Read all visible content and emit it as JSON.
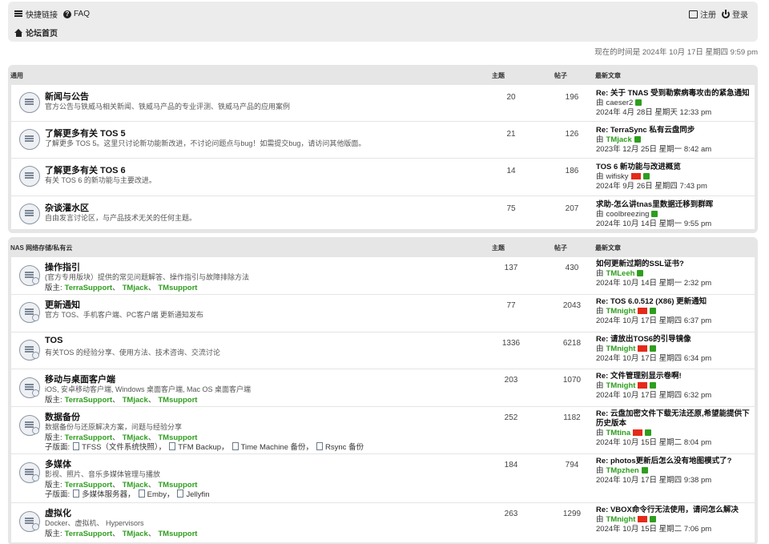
{
  "nav": {
    "quicklinks": "快捷链接",
    "faq": "FAQ",
    "home": "论坛首页",
    "register": "注册",
    "login": "登录"
  },
  "time": "现在的时间是 2024年 10月 17日 星期四 9:59 pm",
  "sections": [
    {
      "name": "通用",
      "col_topics": "主题",
      "col_posts": "帖子",
      "col_last": "最新文章",
      "forums": [
        {
          "title": "新闻与公告",
          "desc": "官方公告与铁威马相关新闻、铁威马产品的专业评测、铁威马产品的应用案例",
          "topics": "20",
          "posts": "196",
          "last_title": "Re: 关于 TNAS 受到勒索病毒攻击的紧急通知",
          "by": "由",
          "author": "caeser2",
          "author_plain": true,
          "flag": false,
          "date": "2024年 4月 28日 星期天 12:33 pm"
        },
        {
          "title": "了解更多有关 TOS 5",
          "desc": "了解更多 TOS 5。这里只讨论新功能新改进，不讨论问题点与bug！如需提交bug，请访问其他版面。",
          "topics": "21",
          "posts": "126",
          "last_title": "Re: TerraSync 私有云盘同步",
          "by": "由",
          "author": "TMjack",
          "author_plain": false,
          "flag": false,
          "date": "2023年 12月 25日 星期一 8:42 am"
        },
        {
          "title": "了解更多有关 TOS 6",
          "desc": "有关 TOS 6 的新功能与主要改进。",
          "topics": "14",
          "posts": "186",
          "last_title": "TOS 6 新功能与改进概览",
          "by": "由",
          "author": "wifisky",
          "author_plain": true,
          "flag": true,
          "date": "2024年 9月 26日 星期四 7:43 pm"
        },
        {
          "title": "杂谈灌水区",
          "desc": "自由发言讨论区，与产品技术无关的任何主题。",
          "topics": "75",
          "posts": "207",
          "last_title": "求助-怎么讲tnas里数据迁移到群晖",
          "by": "由",
          "author": "coolbreezing",
          "author_plain": true,
          "flag": false,
          "date": "2024年 10月 14日 星期一 9:55 pm"
        }
      ]
    },
    {
      "name": "NAS 网络存储/私有云",
      "col_topics": "主题",
      "col_posts": "帖子",
      "col_last": "最新文章",
      "forums": [
        {
          "title": "操作指引",
          "desc": "(官方专用版块）提供的常见问题解答、操作指引与故障排除方法",
          "mods_label": "版主:",
          "mods": [
            "TerraSupport",
            "TMjack",
            "TMsupport"
          ],
          "topics": "137",
          "posts": "430",
          "last_title": "如何更新过期的SSL证书?",
          "by": "由",
          "author": "TMLeeh",
          "author_plain": false,
          "flag": false,
          "date": "2024年 10月 14日 星期一 2:32 pm"
        },
        {
          "title": "更新通知",
          "desc": "官方 TOS、手机客户端、PC客户端 更新通知发布",
          "topics": "77",
          "posts": "2043",
          "last_title": "Re: TOS 6.0.512 (X86) 更新通知",
          "by": "由",
          "author": "TMnight",
          "author_plain": false,
          "flag": true,
          "date": "2024年 10月 17日 星期四 6:37 pm"
        },
        {
          "title": "TOS",
          "desc": "有关TOS 的经验分享、使用方法、技术咨询、交流讨论",
          "topics": "1336",
          "posts": "6218",
          "last_title": "Re: 请放出TOS6的引导镜像",
          "by": "由",
          "author": "TMnight",
          "author_plain": false,
          "flag": true,
          "date": "2024年 10月 17日 星期四 6:34 pm"
        },
        {
          "title": "移动与桌面客户端",
          "desc": "iOS, 安卓移动客户端, Windows 桌面客户端, Mac OS 桌面客户端",
          "mods_label": "版主:",
          "mods": [
            "TerraSupport",
            "TMjack",
            "TMsupport"
          ],
          "topics": "203",
          "posts": "1070",
          "last_title": "Re: 文件管理别显示卷啊!",
          "by": "由",
          "author": "TMnight",
          "author_plain": false,
          "flag": true,
          "date": "2024年 10月 17日 星期四 6:32 pm"
        },
        {
          "title": "数据备份",
          "desc": "数据备份与还原解决方案，问题与经验分享",
          "mods_label": "版主:",
          "mods": [
            "TerraSupport",
            "TMjack",
            "TMsupport"
          ],
          "subs_label": "子版面:",
          "subs": [
            "TFSS（文件系统快照）",
            "TFM Backup",
            "Time Machine 备份",
            "Rsync 备份"
          ],
          "topics": "252",
          "posts": "1182",
          "last_title": "Re: 云盘加密文件下载无法还原,希望能提供下历史版本",
          "by": "由",
          "author": "TMtina",
          "author_plain": false,
          "flag": true,
          "date": "2024年 10月 15日 星期二 8:04 pm"
        },
        {
          "title": "多媒体",
          "desc": "影视、照片、音乐多媒体管理与播放",
          "mods_label": "版主:",
          "mods": [
            "TerraSupport",
            "TMjack",
            "TMsupport"
          ],
          "subs_label": "子版面:",
          "subs": [
            "多媒体服务器",
            "Emby",
            "Jellyfin"
          ],
          "topics": "184",
          "posts": "794",
          "last_title": "Re: photos更新后怎么没有地图模式了?",
          "by": "由",
          "author": "TMpzhen",
          "author_plain": false,
          "flag": false,
          "date": "2024年 10月 17日 星期四 9:38 pm"
        },
        {
          "title": "虚拟化",
          "desc": "Docker、虚拟机、 Hypervisors",
          "mods_label": "版主:",
          "mods": [
            "TerraSupport",
            "TMjack",
            "TMsupport"
          ],
          "topics": "263",
          "posts": "1299",
          "last_title": "Re: VBOX命令行无法使用，请问怎么解决",
          "by": "由",
          "author": "TMnight",
          "author_plain": false,
          "flag": true,
          "date": "2024年 10月 15日 星期二 7:06 pm"
        }
      ]
    }
  ]
}
